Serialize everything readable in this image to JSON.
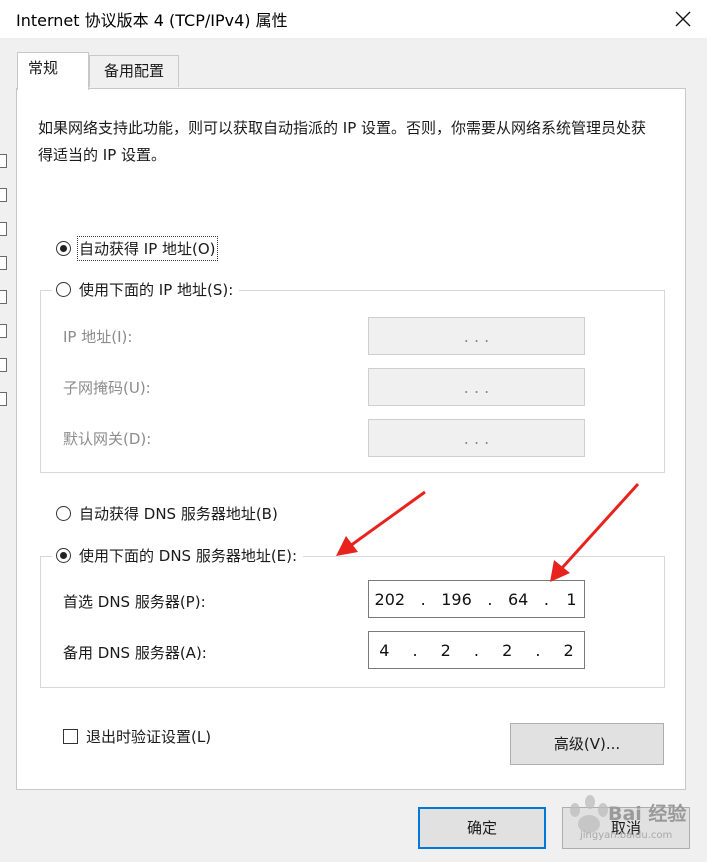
{
  "window": {
    "title": "Internet 协议版本 4 (TCP/IPv4) 属性",
    "close_glyph": "close-icon"
  },
  "tabs": [
    {
      "label": "常规",
      "active": true
    },
    {
      "label": "备用配置",
      "active": false
    }
  ],
  "description": "如果网络支持此功能，则可以获取自动指派的 IP 设置。否则，你需要从网络系统管理员处获得适当的 IP 设置。",
  "ip_section": {
    "auto_ip": {
      "label": "自动获得 IP 地址(O)",
      "selected": true
    },
    "manual_ip": {
      "label": "使用下面的 IP 地址(S):",
      "selected": false
    },
    "fields": [
      {
        "label": "IP 地址(I):",
        "value": ".     .     .",
        "enabled": false
      },
      {
        "label": "子网掩码(U):",
        "value": ".     .     .",
        "enabled": false
      },
      {
        "label": "默认网关(D):",
        "value": ".     .     .",
        "enabled": false
      }
    ]
  },
  "dns_section": {
    "auto_dns": {
      "label": "自动获得 DNS 服务器地址(B)",
      "selected": false
    },
    "manual_dns": {
      "label": "使用下面的 DNS 服务器地址(E):",
      "selected": true
    },
    "preferred": {
      "label": "首选 DNS 服务器(P):",
      "octets": [
        "202",
        "196",
        "64",
        "1"
      ]
    },
    "alternate": {
      "label": "备用 DNS 服务器(A):",
      "octets": [
        "4",
        "2",
        "2",
        "2"
      ]
    }
  },
  "validate_on_exit": {
    "label": "退出时验证设置(L)",
    "checked": false
  },
  "buttons": {
    "advanced": "高级(V)...",
    "ok": "确定",
    "cancel": "取消"
  },
  "annotations": {
    "arrow_color": "#e8231e"
  },
  "watermark": {
    "text": "Bai 经验",
    "sub": "jingyan.baidu.com"
  },
  "colors": {
    "dialog_bg": "#f0f0f0",
    "panel_bg": "#ffffff",
    "ok_border": "#0078d7"
  }
}
